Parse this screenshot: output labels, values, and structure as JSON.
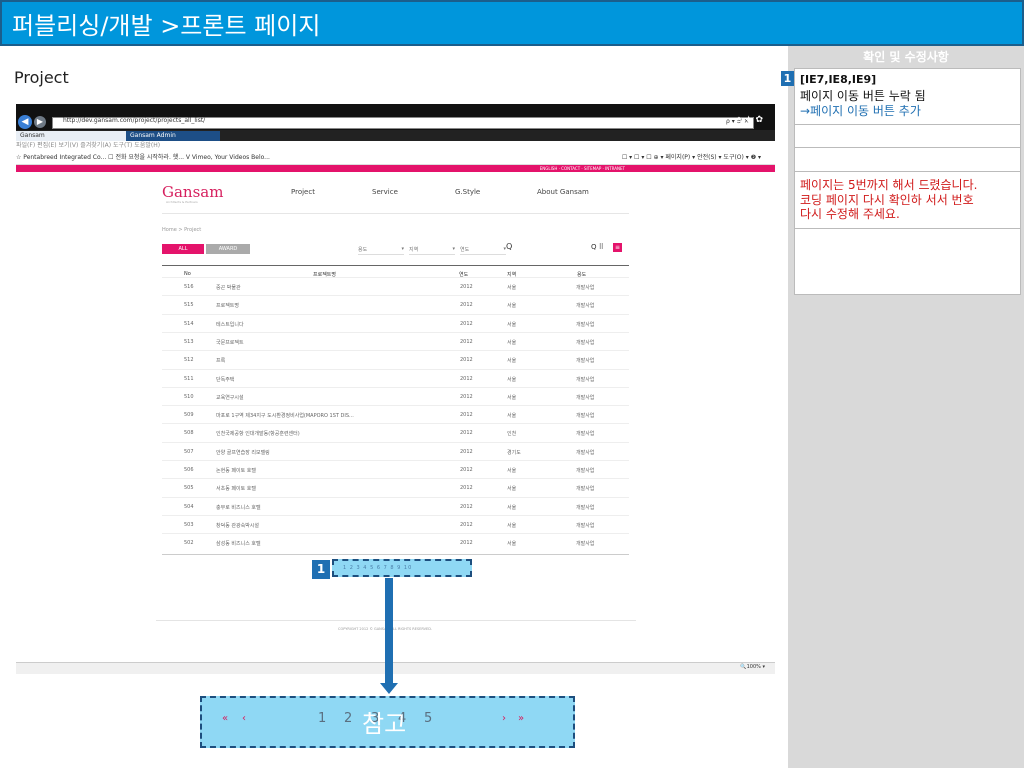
{
  "header": {
    "title": "퍼블리싱/개발 >프론트 페이지"
  },
  "section_label": "Project",
  "browser": {
    "address": "http://dev.gansam.com/project/projects_all_list/",
    "address_controls": "ρ ▾ ♂ ✕",
    "nav_icons": "⌂ ★ ✿",
    "tabs": [
      "Gansam",
      "Gansam Admin"
    ],
    "menu": "파일(F)  편집(E)  보기(V)  즐겨찾기(A)  도구(T)  도움말(H)",
    "favorites": "☆  Pentabreed Integrated Co...  ☐ 전화 요청을 시작하라. 햇...  V Vimeo, Your Videos Belo...",
    "favorites_right": "☐ ▾ ☐ ▾ ☐ ⊕ ▾ 페이지(P) ▾ 안전(S) ▾ 도구(O) ▾ ❷ ▾",
    "pink_links": "ENGLISH · CONTACT · SITEMAP · INTRANET",
    "zoom": "🔍100% ▾"
  },
  "site": {
    "logo": "Gansam",
    "logo_sub": "Architects & Partners",
    "nav": [
      "Project",
      "Service",
      "G.Style",
      "About Gansam"
    ],
    "breadcrumb": "Home > Project",
    "tabs": {
      "all": "ALL",
      "award": "AWARD"
    },
    "filters": [
      "용도",
      "지역",
      "연도"
    ],
    "search_icon": "Q",
    "view_icons": "Q ⠿",
    "list_view": "≡",
    "columns": [
      "No",
      "프로젝트명",
      "연도",
      "지역",
      "용도"
    ],
    "rows": [
      [
        "516",
        "중곤 박물관",
        "2012",
        "서울",
        "개발사업"
      ],
      [
        "515",
        "프로젝트명",
        "2012",
        "서울",
        "개발사업"
      ],
      [
        "514",
        "테스트입니다",
        "2012",
        "서울",
        "개발사업"
      ],
      [
        "513",
        "국문프로젝트",
        "2012",
        "서울",
        "개발사업"
      ],
      [
        "512",
        "프록",
        "2012",
        "서울",
        "개발사업"
      ],
      [
        "511",
        "단독주택",
        "2012",
        "서울",
        "개발사업"
      ],
      [
        "510",
        "교육연구시설",
        "2012",
        "서울",
        "개발사업"
      ],
      [
        "509",
        "마포로 1구역 제34지구 도시환경정비사업(MAPORO 1ST DIS...",
        "2012",
        "서울",
        "개발사업"
      ],
      [
        "508",
        "인천국제공항 인대개발동(항공훈련센터)",
        "2012",
        "인천",
        "개발사업"
      ],
      [
        "507",
        "안양 골프연습장 리모델링",
        "2012",
        "경기도",
        "개발사업"
      ],
      [
        "506",
        "논현동 페이토 호텔",
        "2012",
        "서울",
        "개발사업"
      ],
      [
        "505",
        "서초동 페이토 호텔",
        "2012",
        "서울",
        "개발사업"
      ],
      [
        "504",
        "충무로 비즈니스 호텔",
        "2012",
        "서울",
        "개발사업"
      ],
      [
        "503",
        "창덕동 관광숙박시설",
        "2012",
        "서울",
        "개발사업"
      ],
      [
        "502",
        "삼성동 비즈니스 호텔",
        "2012",
        "서울",
        "개발사업"
      ]
    ],
    "pagination": "1 2 3 4 5 6 7 8 9 10",
    "copyright": "COPYRIGHT 2012 © GANSAM ALL RIGHTS RESERVED."
  },
  "annotation": {
    "badge": "1"
  },
  "reference": {
    "first": "«",
    "prev": "‹",
    "pages": [
      "1",
      "2",
      "3",
      "4",
      "5"
    ],
    "next": "›",
    "last": "»",
    "label": "참고"
  },
  "side_panel": {
    "title": "확인 및 수정사항",
    "badge": "1",
    "tag": "[IE7,IE8,IE9]",
    "line2": "페이지 이동 버튼 누락 됨",
    "line3": "→페이지 이동 버튼 추가",
    "note": [
      "페이지는 5번까지 해서 드렸습니다.",
      "코딩 페이지 다시 확인하 서서 번호",
      "다시 수정해 주세요."
    ]
  },
  "colors": {
    "brand": "#0096dc",
    "accent": "#e4136b",
    "annotation_blue": "#1f6fb2",
    "annotation_fill": "#8fd8f4"
  }
}
